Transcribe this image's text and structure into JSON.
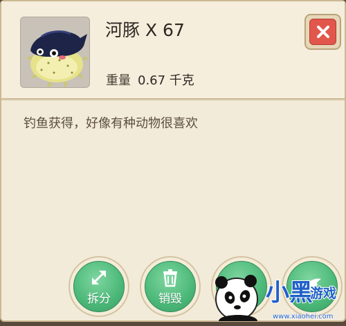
{
  "item": {
    "name": "河豚",
    "quantity": "X 67",
    "weight_label": "重量",
    "weight_value": "0.67 千克",
    "description": "钓鱼获得，好像有种动物很喜欢",
    "icon": "pufferfish-icon"
  },
  "actions": [
    {
      "label": "拆分",
      "icon": "split-arrows-icon"
    },
    {
      "label": "销毁",
      "icon": "trash-icon"
    },
    {
      "label": "",
      "icon": "action-icon"
    },
    {
      "label": "",
      "icon": "wing-icon"
    }
  ],
  "close": {
    "icon": "close-icon"
  },
  "watermark": {
    "text": "小黑游戏",
    "url_text": "www.xiaohei.com"
  },
  "colors": {
    "panel": "#f3ebd9",
    "accent_green": "#4bb878",
    "close_red": "#e2574c"
  }
}
